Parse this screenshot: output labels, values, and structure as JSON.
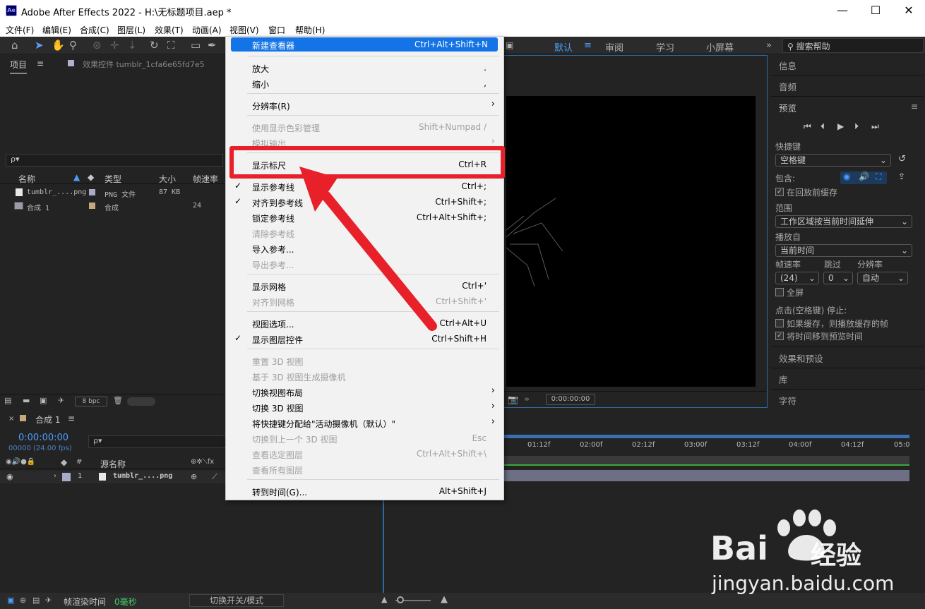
{
  "window": {
    "title": "Adobe After Effects 2022 - H:\\无标题项目.aep *",
    "app_icon_text": "Ae",
    "minimize": "—",
    "maximize": "☐",
    "close": "✕"
  },
  "menubar": [
    "文件(F)",
    "编辑(E)",
    "合成(C)",
    "图层(L)",
    "效果(T)",
    "动画(A)",
    "视图(V)",
    "窗口",
    "帮助(H)"
  ],
  "workspaces": {
    "items": [
      "默认",
      "审阅",
      "学习",
      "小屏幕"
    ],
    "overflow": "»",
    "search_placeholder": "搜索帮助"
  },
  "project_panel": {
    "tab_project": "项目",
    "tab_effects": "效果控件 tumblr_1cfa6e65fd7e5",
    "search_glyph": "ρ▾",
    "columns": [
      "名称",
      "类型",
      "大小",
      "帧速率"
    ],
    "rows": [
      {
        "name": "tumblr_....png",
        "type": "PNG 文件",
        "size": "87 KB",
        "fps": ""
      },
      {
        "name": "合成 1",
        "type": "合成",
        "size": "",
        "fps": "24"
      }
    ],
    "bpc": "8 bpc"
  },
  "viewer": {
    "timecode": "0:00:00:00"
  },
  "right_panel": {
    "info": "信息",
    "audio": "音频",
    "preview": "预览",
    "shortcut_label": "快捷键",
    "shortcut_value": "空格键",
    "include_label": "包含:",
    "cache_before_play": "在回放前缓存",
    "range_label": "范围",
    "range_value": "工作区域按当前时间延伸",
    "play_from_label": "播放自",
    "play_from_value": "当前时间",
    "fps_label": "帧速率",
    "skip_label": "跳过",
    "resolution_label": "分辨率",
    "fps_value": "(24)",
    "skip_value": "0",
    "resolution_value": "自动",
    "fullscreen": "全屏",
    "stop_label": "点击(空格键) 停止:",
    "if_cached": "如果缓存，则播放缓存的帧",
    "move_time": "将时间移到预览时间",
    "effects_presets": "效果和预设",
    "library": "库",
    "character": "字符"
  },
  "timeline": {
    "tab": "合成 1",
    "timecode": "0:00:00:00",
    "frames": "00000 (24.00 fps)",
    "col_source": "源名称",
    "layer_num": "1",
    "layer_name": "tumblr_....png",
    "ruler": [
      "01:12f",
      "02:00f",
      "02:12f",
      "03:00f",
      "03:12f",
      "04:00f",
      "04:12f",
      "05:0"
    ]
  },
  "statusbar": {
    "render_time_label": "帧渲染时间",
    "render_time_value": "0毫秒",
    "toggle": "切换开关/模式"
  },
  "view_menu": {
    "items": [
      {
        "label": "新建查看器",
        "shortcut": "Ctrl+Alt+Shift+N",
        "state": "highlighted"
      },
      {
        "label": "放大",
        "shortcut": "."
      },
      {
        "label": "缩小",
        "shortcut": ","
      },
      {
        "label": "分辨率(R)",
        "submenu": true
      },
      {
        "label": "使用显示色彩管理",
        "shortcut": "Shift+Numpad /",
        "state": "disabled"
      },
      {
        "label": "模拟输出",
        "submenu": true,
        "state": "disabled"
      },
      {
        "label": "显示标尺",
        "shortcut": "Ctrl+R"
      },
      {
        "label": "显示参考线",
        "shortcut": "Ctrl+;",
        "checked": true
      },
      {
        "label": "对齐到参考线",
        "shortcut": "Ctrl+Shift+;",
        "checked": true
      },
      {
        "label": "锁定参考线",
        "shortcut": "Ctrl+Alt+Shift+;"
      },
      {
        "label": "清除参考线",
        "state": "disabled"
      },
      {
        "label": "导入参考...",
        "shortcut": ""
      },
      {
        "label": "导出参考...",
        "state": "disabled"
      },
      {
        "label": "显示网格",
        "shortcut": "Ctrl+'"
      },
      {
        "label": "对齐到网格",
        "shortcut": "Ctrl+Shift+'",
        "state": "disabled"
      },
      {
        "label": "视图选项...",
        "shortcut": "Ctrl+Alt+U"
      },
      {
        "label": "显示图层控件",
        "shortcut": "Ctrl+Shift+H",
        "checked": true
      },
      {
        "label": "重置 3D 视图",
        "state": "disabled"
      },
      {
        "label": "基于 3D 视图生成摄像机",
        "state": "disabled"
      },
      {
        "label": "切换视图布局",
        "submenu": true
      },
      {
        "label": "切换 3D 视图",
        "submenu": true
      },
      {
        "label": "将快捷键分配给\"活动摄像机（默认）\"",
        "submenu": true
      },
      {
        "label": "切换到上一个 3D 视图",
        "shortcut": "Esc",
        "state": "disabled"
      },
      {
        "label": "查看选定图层",
        "shortcut": "Ctrl+Alt+Shift+\\",
        "state": "disabled"
      },
      {
        "label": "查看所有图层",
        "state": "disabled"
      },
      {
        "label": "转到时间(G)...",
        "shortcut": "Alt+Shift+J"
      }
    ]
  },
  "watermark": {
    "brand": "Bai",
    "brand2": "经验",
    "url": "jingyan.baidu.com"
  },
  "colors": {
    "highlight": "#1473e6",
    "annotation_red": "#e8202a"
  }
}
